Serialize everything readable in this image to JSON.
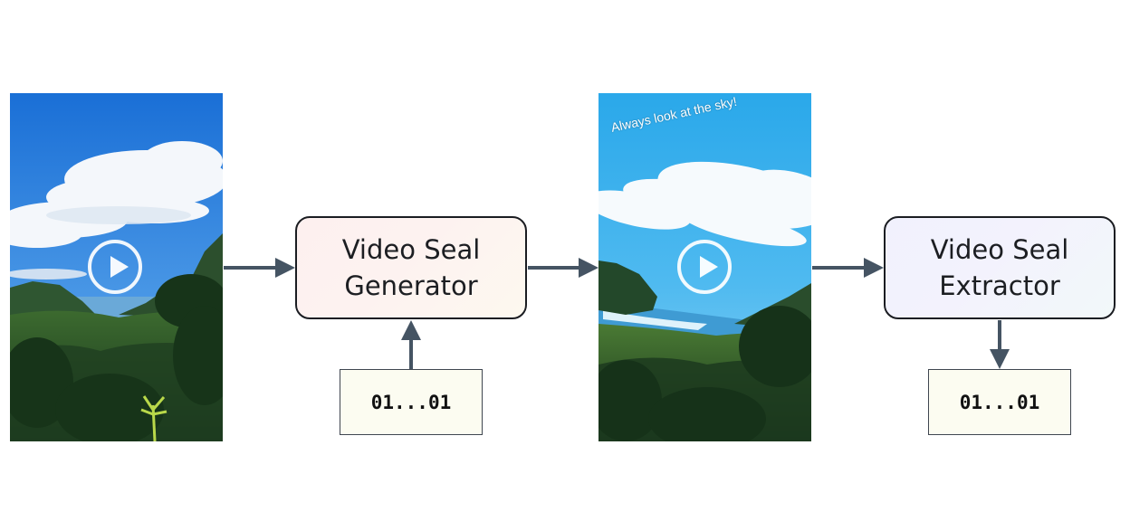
{
  "input_video": {
    "play_icon": "play-circle-icon"
  },
  "generator": {
    "line1": "Video Seal",
    "line2": "Generator"
  },
  "watermarked_video": {
    "caption": "Always look at the sky!",
    "play_icon": "play-circle-icon"
  },
  "extractor": {
    "line1": "Video Seal",
    "line2": "Extractor"
  },
  "message_in": "01...01",
  "message_out": "01...01",
  "colors": {
    "arrow": "#455463",
    "box_border": "#1b1d22",
    "message_fill": "#fcfcf1"
  }
}
